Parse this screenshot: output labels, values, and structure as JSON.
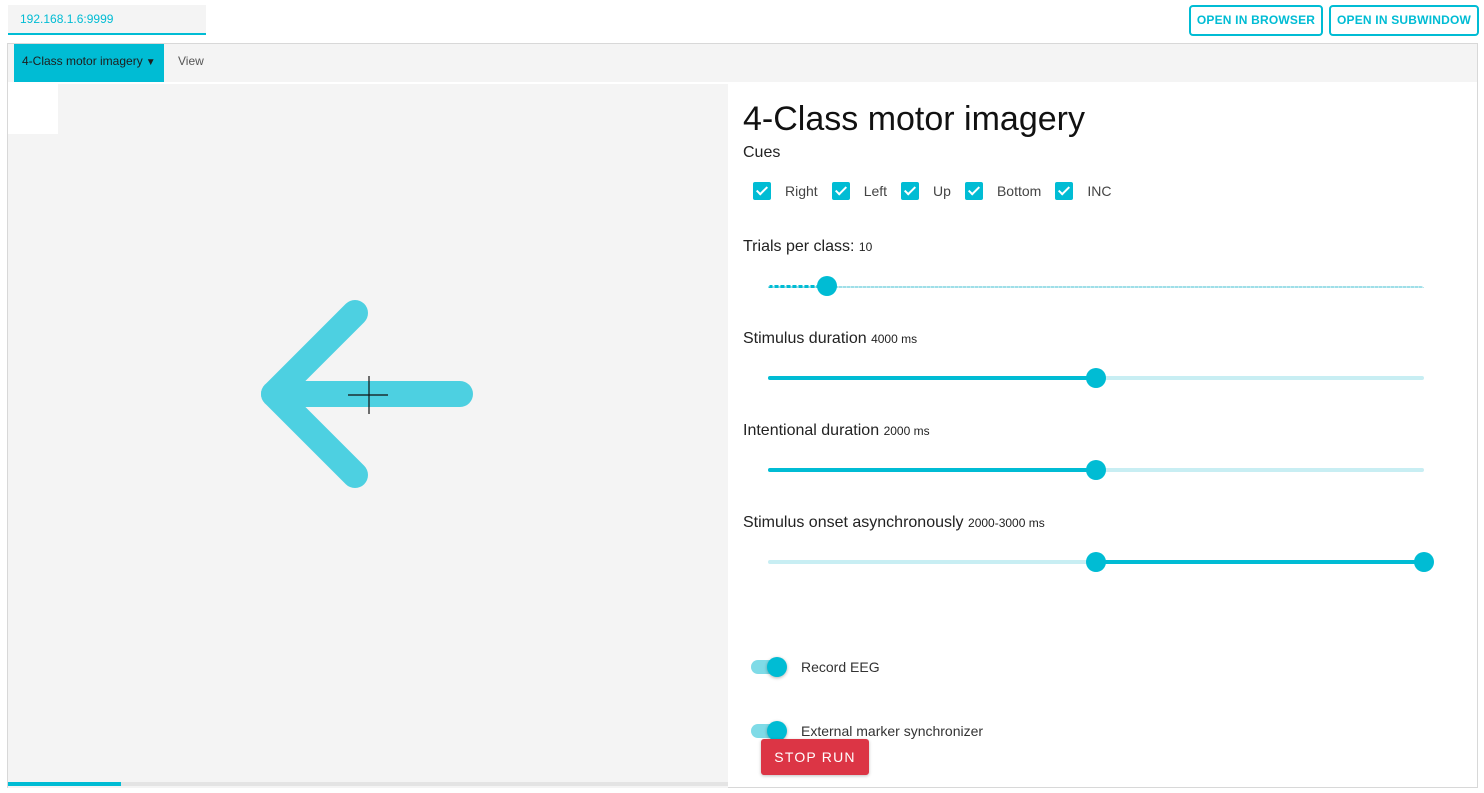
{
  "topbar": {
    "url": "192.168.1.6:9999",
    "open_in_browser": "OPEN IN BROWSER",
    "open_in_subwindow": "OPEN IN SUBWINDOW"
  },
  "tabs": {
    "active": "4-Class motor imagery",
    "view": "View"
  },
  "stage": {
    "cue_icon": "arrow-left-icon",
    "fixation_icon": "crosshair-icon",
    "arrow_color": "#4dd0e1",
    "progress_fraction": 0.157
  },
  "panel": {
    "title": "4-Class motor imagery",
    "cues_label": "Cues",
    "cues": [
      {
        "label": "Right",
        "checked": true
      },
      {
        "label": "Left",
        "checked": true
      },
      {
        "label": "Up",
        "checked": true
      },
      {
        "label": "Bottom",
        "checked": true
      },
      {
        "label": "INC",
        "checked": true
      }
    ],
    "trials": {
      "label": "Trials per class:",
      "value_text": "10",
      "fraction": 0.09
    },
    "stimulus_duration": {
      "label": "Stimulus duration",
      "value_text": "4000 ms",
      "fraction": 0.5
    },
    "intentional_duration": {
      "label": "Intentional duration",
      "value_text": "2000 ms",
      "fraction": 0.5
    },
    "onset_async": {
      "label": "Stimulus onset asynchronously",
      "value_text": "2000-3000 ms",
      "range_fraction": [
        0.5,
        1.0
      ]
    },
    "record_eeg": {
      "label": "Record EEG",
      "on": true
    },
    "external_marker": {
      "label": "External marker synchronizer",
      "on": true
    },
    "stop_button": "STOP RUN"
  },
  "colors": {
    "accent": "#00bcd4",
    "danger": "#dc3545",
    "stage_bg": "#f4f4f4"
  }
}
